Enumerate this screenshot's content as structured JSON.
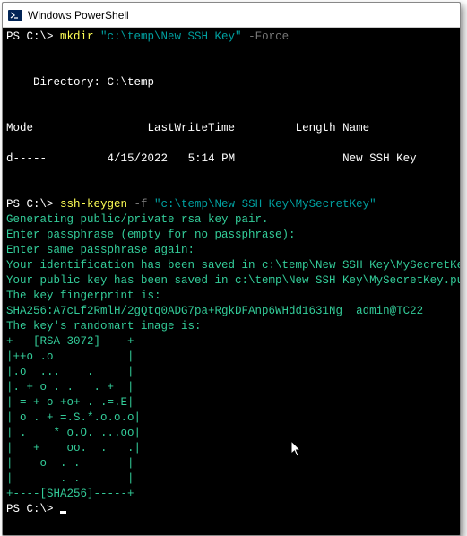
{
  "titlebar": {
    "title": "Windows PowerShell"
  },
  "line1": {
    "prompt": "PS C:\\> ",
    "cmd": "mkdir",
    "arg": " \"c:\\temp\\New SSH Key\"",
    "flag": " -Force"
  },
  "dir": {
    "label": "    Directory: C:\\temp"
  },
  "hdr": {
    "mode": "Mode",
    "lwt": "LastWriteTime",
    "len": "Length",
    "name": "Name"
  },
  "dash": {
    "mode": "----",
    "lwt": "-------------",
    "len": "------",
    "name": "----"
  },
  "row": {
    "mode": "d-----",
    "date": "4/15/2022",
    "time": "5:14 PM",
    "name": "New SSH Key"
  },
  "line2": {
    "prompt": "PS C:\\> ",
    "cmd": "ssh-keygen",
    "flag": " -f ",
    "arg": "\"c:\\temp\\New SSH Key\\MySecretKey\""
  },
  "out": {
    "l1": "Generating public/private rsa key pair.",
    "l2": "Enter passphrase (empty for no passphrase):",
    "l3": "Enter same passphrase again:",
    "l4": "Your identification has been saved in c:\\temp\\New SSH Key\\MySecretKey.",
    "l5": "Your public key has been saved in c:\\temp\\New SSH Key\\MySecretKey.pub.",
    "l6": "The key fingerprint is:",
    "l7": "SHA256:A7cLf2RmlH/2gQtq0ADG7pa+RgkDFAnp6WHdd1631Ng  admin@TC22",
    "l8": "The key's randomart image is:"
  },
  "art": {
    "l1": "+---[RSA 3072]----+",
    "l2": "|++o .o           |",
    "l3": "|.o  ...    .     |",
    "l4": "|. + o . .   . +  |",
    "l5": "| = + o +o+ . .=.E|",
    "l6": "| o . + =.S.*.o.o.o|",
    "l7": "| .    * o.O. ...oo|",
    "l8": "|   +    oo.  .   .|",
    "l9": "|    o  . .       |",
    "l10": "|       . .       |",
    "l11": "+----[SHA256]-----+"
  },
  "prompt_end": "PS C:\\> "
}
